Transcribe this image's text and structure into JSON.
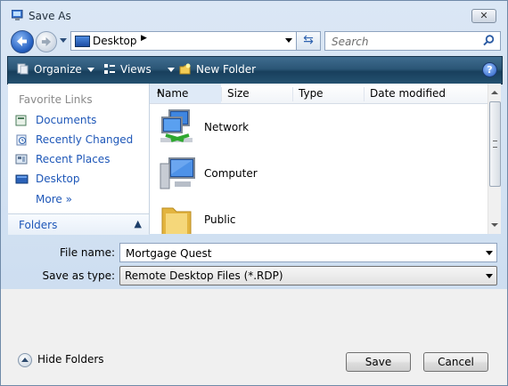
{
  "window": {
    "title": "Save As",
    "close_label": "✕"
  },
  "nav": {
    "address": "Desktop",
    "search_placeholder": "Search"
  },
  "toolbar": {
    "organize_label": "Organize",
    "views_label": "Views",
    "new_folder_label": "New Folder",
    "help_label": "?"
  },
  "sidebar": {
    "favorites_title": "Favorite Links",
    "links": [
      {
        "label": "Documents",
        "icon": "documents-icon"
      },
      {
        "label": "Recently Changed",
        "icon": "recently-changed-icon"
      },
      {
        "label": "Recent Places",
        "icon": "recent-places-icon"
      },
      {
        "label": "Desktop",
        "icon": "desktop-icon"
      }
    ],
    "more_label": "More",
    "more_chevron": "»",
    "folders_label": "Folders",
    "folders_chevron": "▲"
  },
  "file_list": {
    "columns": [
      "Name",
      "Size",
      "Type",
      "Date modified"
    ],
    "items": [
      {
        "name": "Network",
        "icon": "network-icon"
      },
      {
        "name": "Computer",
        "icon": "computer-icon"
      },
      {
        "name": "Public",
        "icon": "folder-icon"
      }
    ]
  },
  "form": {
    "file_name_label": "File name:",
    "file_name_value": "Mortgage Quest",
    "save_type_label": "Save as type:",
    "save_type_value": "Remote Desktop Files (*.RDP)"
  },
  "buttons": {
    "hide_folders": "Hide Folders",
    "save": "Save",
    "cancel": "Cancel"
  }
}
